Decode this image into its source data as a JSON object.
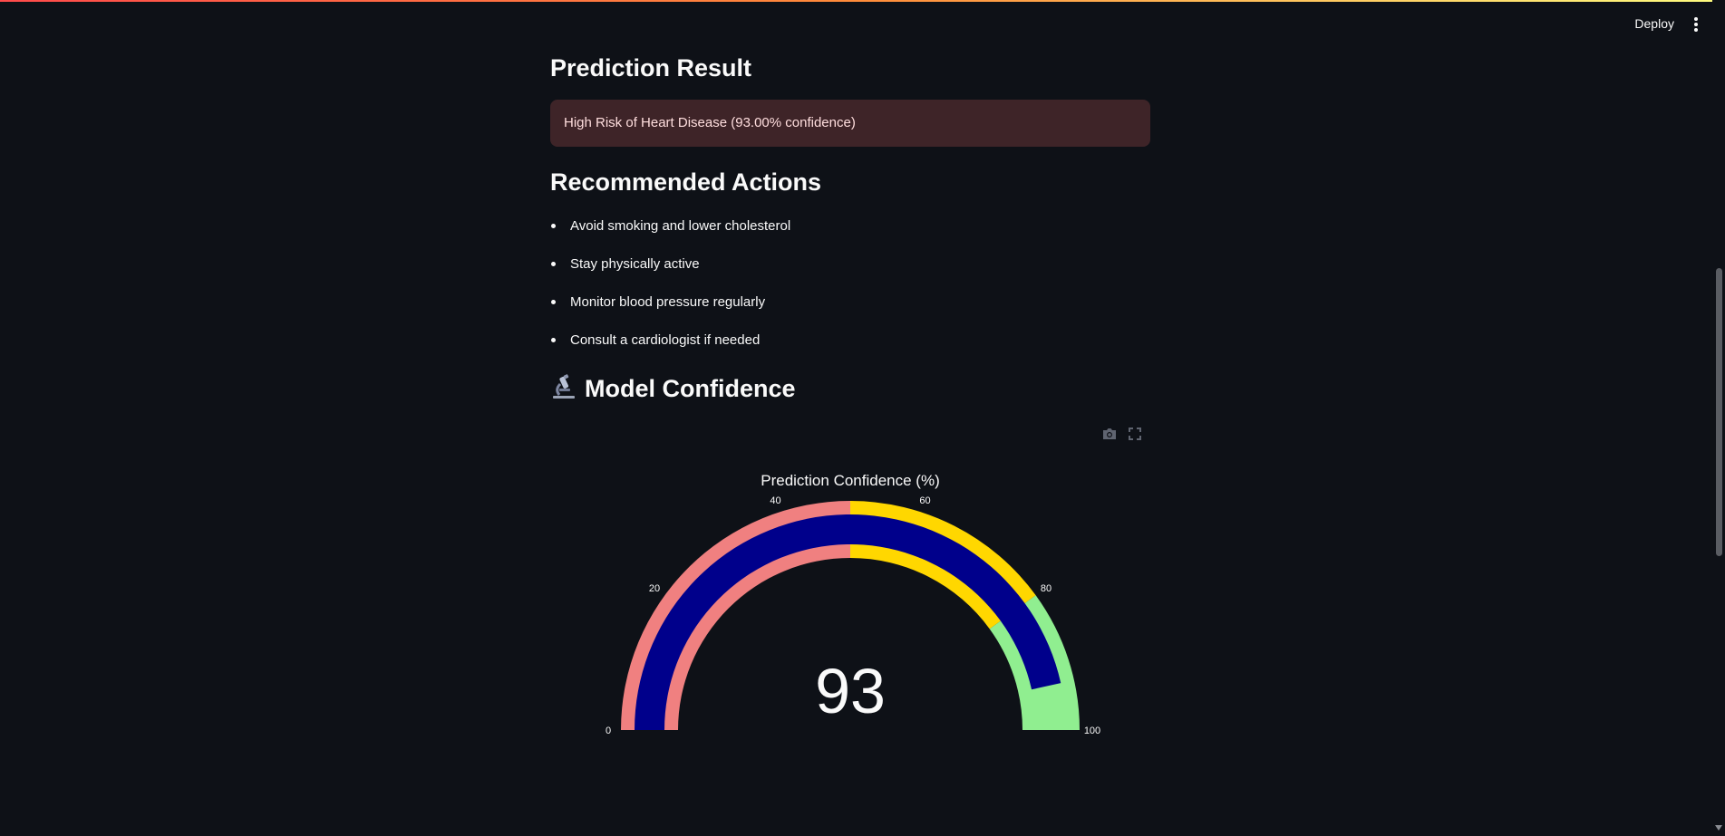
{
  "header": {
    "deploy_label": "Deploy"
  },
  "result": {
    "title": "Prediction Result",
    "alert_text": "High Risk of Heart Disease (93.00% confidence)"
  },
  "actions": {
    "title": "Recommended Actions",
    "items": [
      "Avoid smoking and lower cholesterol",
      "Stay physically active",
      "Monitor blood pressure regularly",
      "Consult a cardiologist if needed"
    ]
  },
  "confidence": {
    "title": "Model Confidence",
    "icon": "microscope-icon"
  },
  "colors": {
    "background": "#0e1117",
    "low_band": "#f08080",
    "mid_band": "#ffd700",
    "high_band": "#90ee90",
    "bar": "#00008b",
    "alert_bg": "#3e2428"
  },
  "chart_data": {
    "type": "gauge",
    "title": "Prediction Confidence (%)",
    "value": 93,
    "value_label": "93",
    "range": [
      0,
      100
    ],
    "ticks": [
      "0",
      "20",
      "40",
      "60",
      "80",
      "100"
    ],
    "tick_values": [
      0,
      20,
      40,
      60,
      80,
      100
    ],
    "steps": [
      {
        "range": [
          0,
          50
        ],
        "color": "#f08080"
      },
      {
        "range": [
          50,
          80
        ],
        "color": "#ffd700"
      },
      {
        "range": [
          80,
          100
        ],
        "color": "#90ee90"
      }
    ],
    "bar_color": "#00008b"
  }
}
